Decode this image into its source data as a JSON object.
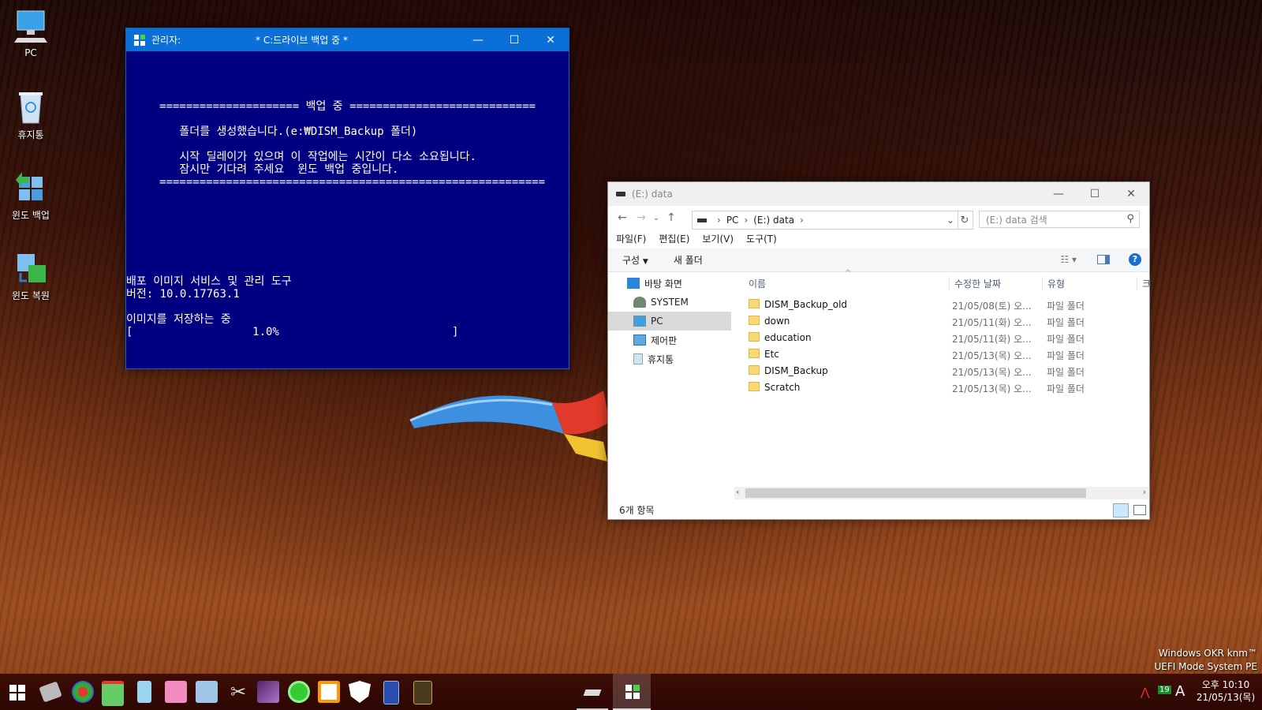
{
  "desktop": {
    "icons": [
      {
        "label": "PC",
        "icon": "computer-icon"
      },
      {
        "label": "휴지통",
        "icon": "recycle-bin-icon"
      },
      {
        "label": "윈도 백업",
        "icon": "backup-icon"
      },
      {
        "label": "윈도 복원",
        "icon": "restore-icon"
      }
    ],
    "watermark": {
      "line1": "Windows OKR  knm™",
      "line2": "UEFI Mode System PE"
    }
  },
  "cmd_window": {
    "title_left": "관리자:",
    "title_center": "*  C:드라이브 백업 중  *",
    "lines": [
      "     ===================== 백업 중 ============================",
      "        폴더를 생성했습니다.(e:₩DISM_Backup 폴더)",
      "        시작 딜레이가 있으며 이 작업에는 시간이 다소 소요됩니다.",
      "        잠시만 기다려 주세요  윈도 백업 중입니다.",
      "     ==========================================================",
      "배포 이미지 서비스 및 관리 도구",
      "버전: 10.0.17763.1",
      "이미지를 저장하는 중",
      "[                  1.0%                          ]"
    ]
  },
  "explorer": {
    "title": "(E:) data",
    "address": {
      "root": "PC",
      "current": "(E:) data"
    },
    "search_placeholder": "(E:) data 검색",
    "menu": [
      "파일(F)",
      "편집(E)",
      "보기(V)",
      "도구(T)"
    ],
    "toolbar": {
      "organize": "구성",
      "new_folder": "새 폴더"
    },
    "nav": [
      {
        "label": "바탕 화면",
        "icon": "desktop-icon"
      },
      {
        "label": "SYSTEM",
        "icon": "user-icon"
      },
      {
        "label": "PC",
        "icon": "computer-icon"
      },
      {
        "label": "제어판",
        "icon": "control-panel-icon"
      },
      {
        "label": "휴지통",
        "icon": "recycle-bin-icon"
      }
    ],
    "columns": {
      "name": "이름",
      "date": "수정한 날짜",
      "type": "유형",
      "more": "크"
    },
    "files": [
      {
        "name": "DISM_Backup_old",
        "date": "21/05/08(토) 오...",
        "type": "파일 폴더"
      },
      {
        "name": "down",
        "date": "21/05/11(화) 오...",
        "type": "파일 폴더"
      },
      {
        "name": "education",
        "date": "21/05/11(화) 오...",
        "type": "파일 폴더"
      },
      {
        "name": "Etc",
        "date": "21/05/13(목) 오...",
        "type": "파일 폴더"
      },
      {
        "name": "DISM_Backup",
        "date": "21/05/13(목) 오...",
        "type": "파일 폴더"
      },
      {
        "name": "Scratch",
        "date": "21/05/13(목) 오...",
        "type": "파일 폴더"
      }
    ],
    "status": "6개 항목"
  },
  "taskbar": {
    "clock_time": "오후 10:10",
    "clock_date": "21/05/13(목)",
    "ime": "A",
    "tray_badge": "19"
  }
}
